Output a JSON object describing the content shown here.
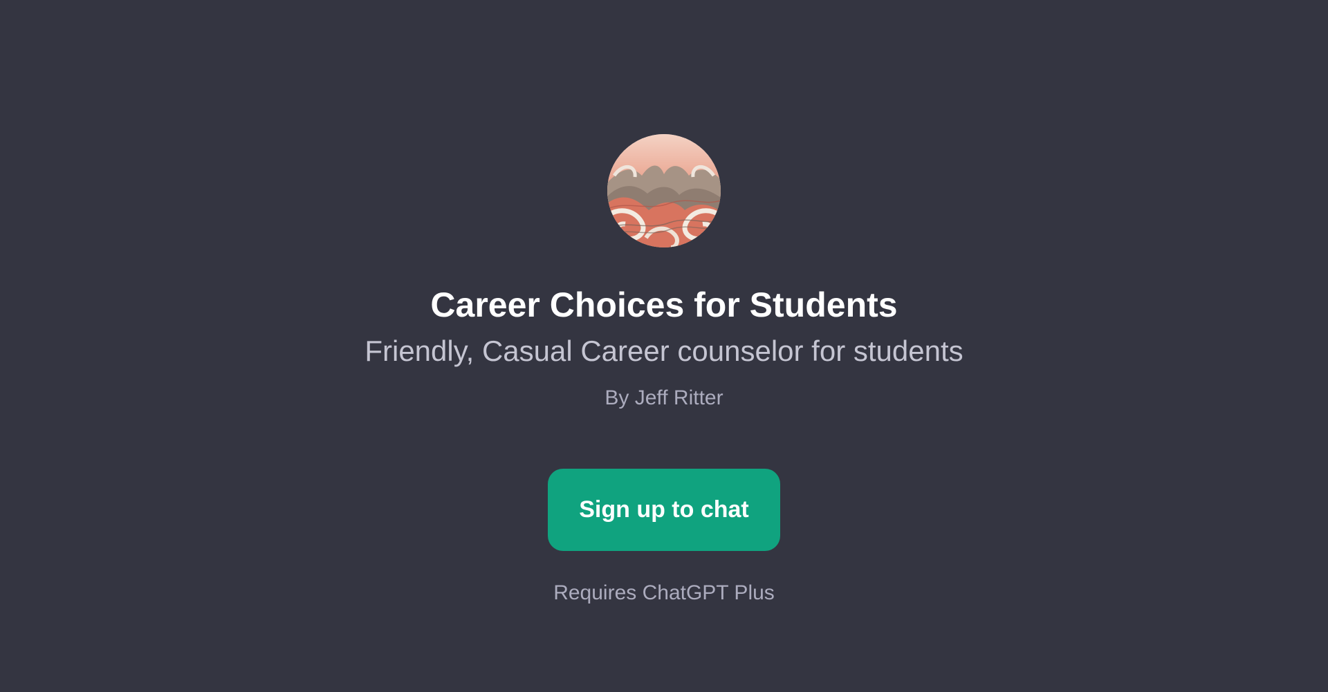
{
  "gpt": {
    "avatar_icon": "abstract-waves-artwork",
    "title": "Career Choices for Students",
    "description": "Friendly, Casual Career counselor for students",
    "author": "By Jeff Ritter"
  },
  "cta": {
    "label": "Sign up to chat"
  },
  "footer": {
    "requirement": "Requires ChatGPT Plus"
  },
  "colors": {
    "background": "#343541",
    "accent": "#10a37f",
    "title": "#ffffff",
    "subtitle": "#c5c5d2",
    "muted": "#acacbe"
  }
}
